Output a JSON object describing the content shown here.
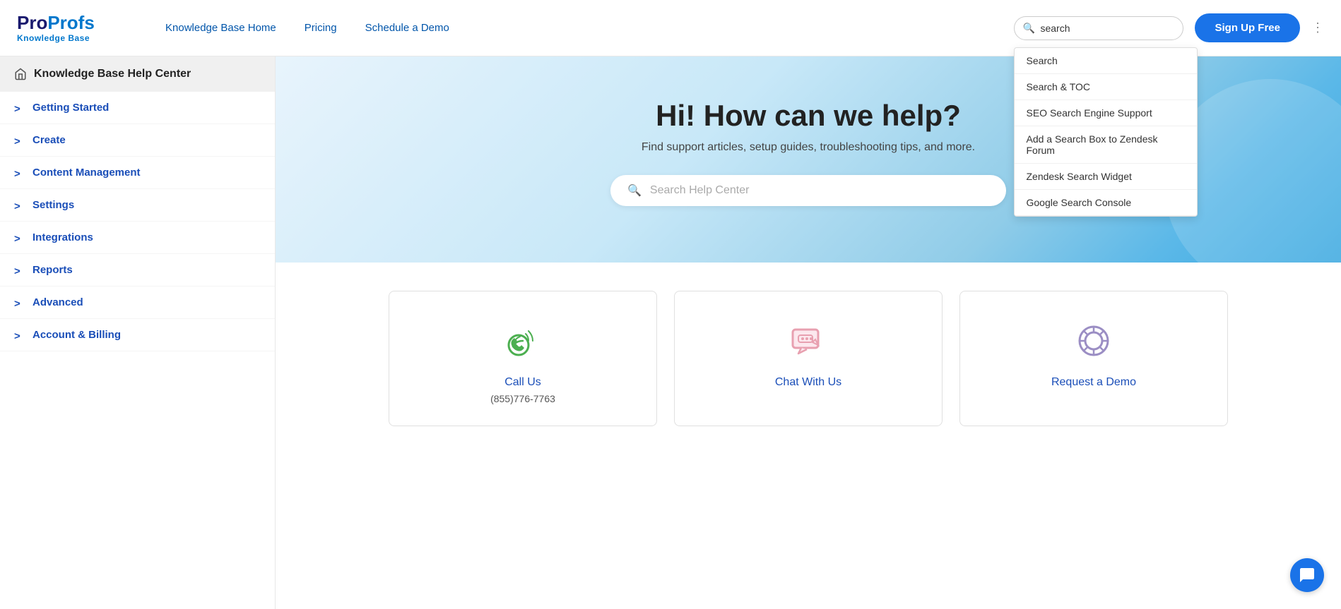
{
  "header": {
    "logo_pro": "Pro",
    "logo_profs": "Profs",
    "logo_sub": "Knowledge Base",
    "nav": [
      {
        "label": "Knowledge Base Home",
        "id": "nav-home"
      },
      {
        "label": "Pricing",
        "id": "nav-pricing"
      },
      {
        "label": "Schedule a Demo",
        "id": "nav-demo"
      }
    ],
    "search_placeholder": "search",
    "signup_label": "Sign Up Free"
  },
  "search_dropdown": {
    "items": [
      {
        "label": "Search",
        "id": "dd-search"
      },
      {
        "label": "Search & TOC",
        "id": "dd-search-toc"
      },
      {
        "label": "SEO Search Engine Support",
        "id": "dd-seo"
      },
      {
        "label": "Add a Search Box to Zendesk Forum",
        "id": "dd-zendesk-forum"
      },
      {
        "label": "Zendesk Search Widget",
        "id": "dd-zendesk-widget"
      },
      {
        "label": "Google Search Console",
        "id": "dd-google-console"
      }
    ]
  },
  "sidebar": {
    "home_label": "Knowledge Base Help Center",
    "items": [
      {
        "label": "Getting Started",
        "id": "sidebar-getting-started"
      },
      {
        "label": "Create",
        "id": "sidebar-create"
      },
      {
        "label": "Content Management",
        "id": "sidebar-content-management"
      },
      {
        "label": "Settings",
        "id": "sidebar-settings"
      },
      {
        "label": "Integrations",
        "id": "sidebar-integrations"
      },
      {
        "label": "Reports",
        "id": "sidebar-reports"
      },
      {
        "label": "Advanced",
        "id": "sidebar-advanced"
      },
      {
        "label": "Account & Billing",
        "id": "sidebar-account-billing"
      }
    ]
  },
  "hero": {
    "title": "Hi! How can we help?",
    "subtitle": "Find support articles, setup guides, troubleshooting tips, and more.",
    "search_placeholder": "Search Help Center"
  },
  "cards": [
    {
      "id": "card-call",
      "title": "Call Us",
      "sub": "(855)776-7763",
      "icon": "phone"
    },
    {
      "id": "card-chat",
      "title": "Chat With Us",
      "sub": "",
      "icon": "chat"
    },
    {
      "id": "card-demo",
      "title": "Request a Demo",
      "sub": "",
      "icon": "lifebuoy"
    }
  ],
  "colors": {
    "brand_blue": "#1a4eb8",
    "accent_blue": "#1a73e8"
  }
}
